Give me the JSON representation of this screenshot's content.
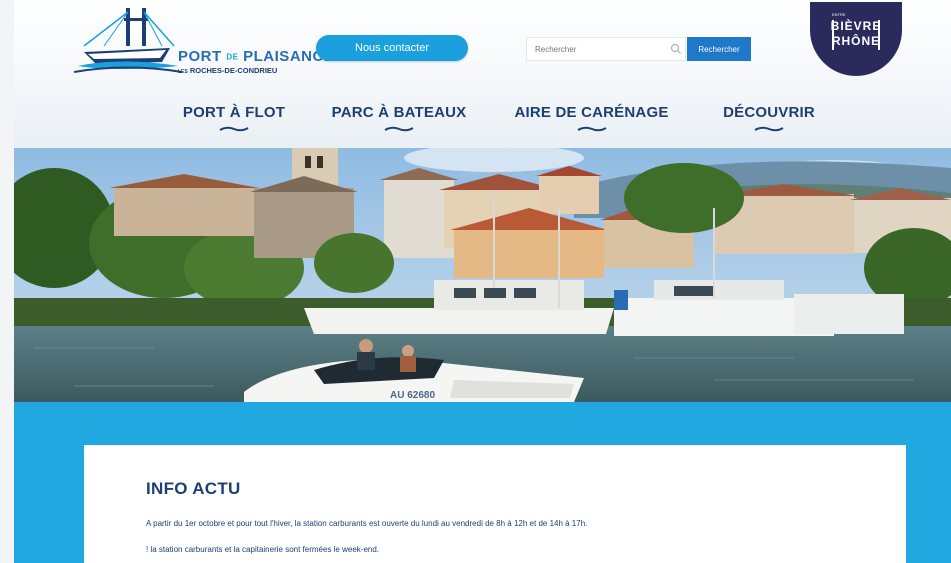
{
  "header": {
    "logo": {
      "title_part1": "PORT",
      "title_de": "DE",
      "title_part2": "PLAISANCE",
      "subtitle_les": "LES",
      "subtitle": "ROCHES-DE-CONDRIEU"
    },
    "contact_button": "Nous contacter",
    "search": {
      "placeholder": "Rechercher",
      "button": "Rechercher"
    },
    "partner_logo": {
      "line1": "BIÈVRE",
      "line2": "RHÔNE",
      "small_text": "ENTRE"
    }
  },
  "nav": {
    "items": [
      {
        "label": "PORT À FLOT"
      },
      {
        "label": "PARC À BATEAUX"
      },
      {
        "label": "AIRE DE CARÉNAGE"
      },
      {
        "label": "DÉCOUVRIR"
      }
    ]
  },
  "hero": {
    "boat_registration": "AU 62680"
  },
  "info": {
    "title": "INFO ACTU",
    "paragraph1": "A partir du 1er octobre et pour tout l'hiver, la station carburants est ouverte du lundi au vendredi de 8h à 12h et de 14h à 17h.",
    "paragraph2": "! la station carburants et la capitainerie sont fermées le week-end."
  },
  "colors": {
    "brand_blue": "#1aa0dc",
    "navy": "#1d3f73",
    "band_blue": "#22a8e0",
    "partner_purple": "#2b2a5c"
  }
}
